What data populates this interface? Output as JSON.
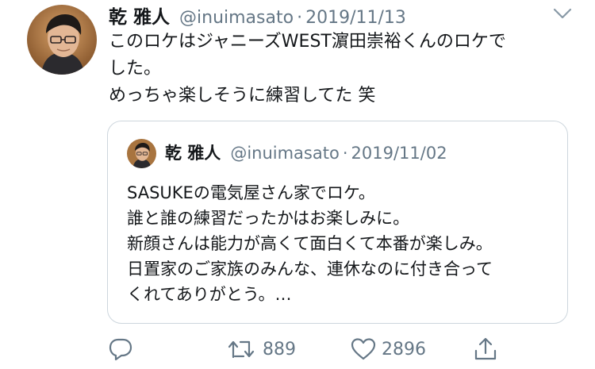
{
  "tweet": {
    "author_name": "乾 雅人",
    "author_handle": "@inuimasato",
    "separator": "·",
    "date": "2019/11/13",
    "lines": [
      "このロケはジャニーズWEST濵田崇裕くんのロケで",
      "した。",
      "めっちゃ楽しそうに練習してた 笑"
    ]
  },
  "quoted": {
    "author_name": "乾 雅人",
    "author_handle": "@inuimasato",
    "separator": "·",
    "date": "2019/11/02",
    "lines": [
      "SASUKEの電気屋さん家でロケ。",
      "誰と誰の練習だったかはお楽しみに。",
      "新顔さんは能力が高くて面白くて本番が楽しみ。",
      "日置家のご家族のみんな、連休なのに付き合って",
      "くれてありがとう。…"
    ]
  },
  "actions": {
    "reply_icon": "reply-icon",
    "retweet_icon": "retweet-icon",
    "retweet_count": "889",
    "like_icon": "heart-icon",
    "like_count": "2896",
    "share_icon": "share-icon"
  },
  "colors": {
    "text": "#14171a",
    "secondary": "#657786",
    "border": "#cdd6dd"
  }
}
